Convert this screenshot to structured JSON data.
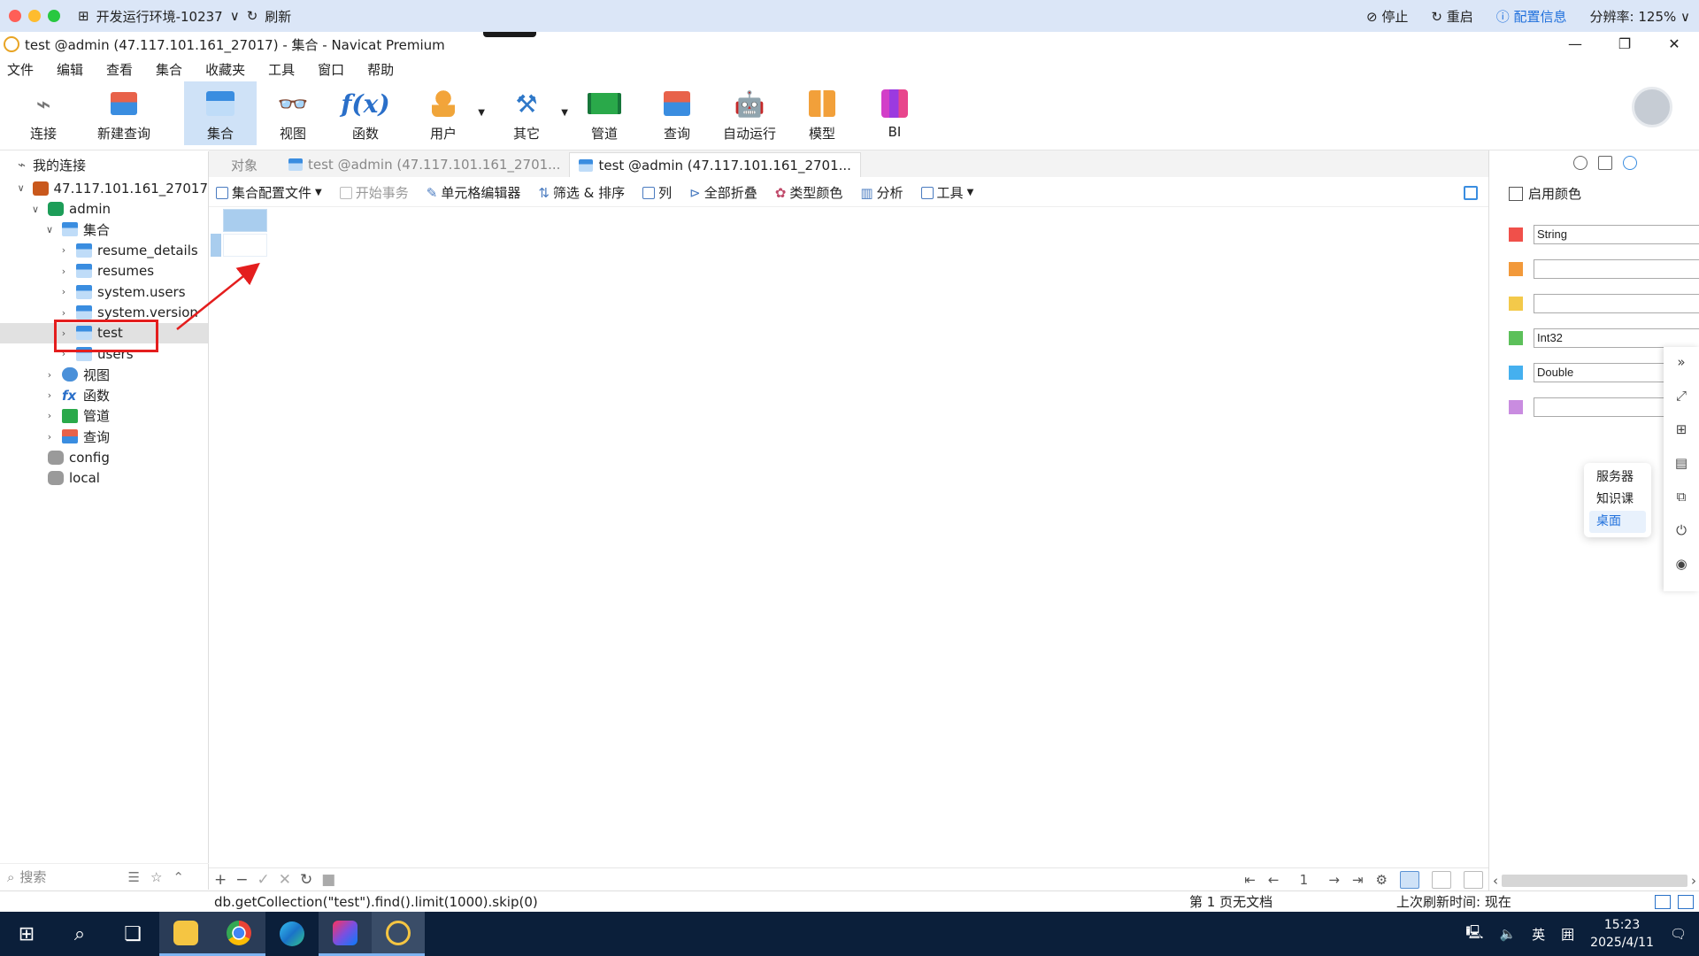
{
  "env": {
    "title": "开发运行环境-10237",
    "refresh": "刷新",
    "stop": "停止",
    "restart": "重启",
    "config": "配置信息",
    "resolution": "分辨率: 125%"
  },
  "window": {
    "title": "test @admin (47.117.101.161_27017) - 集合 - Navicat Premium"
  },
  "menu": [
    "文件",
    "编辑",
    "查看",
    "集合",
    "收藏夹",
    "工具",
    "窗口",
    "帮助"
  ],
  "toolbar": {
    "connect": "连接",
    "new_query": "新建查询",
    "collection": "集合",
    "view": "视图",
    "function": "函数",
    "user": "用户",
    "other": "其它",
    "pipeline": "管道",
    "query": "查询",
    "auto_run": "自动运行",
    "model": "模型",
    "bi": "BI"
  },
  "nav": {
    "header": "我的连接",
    "connection": "47.117.101.161_27017",
    "db_admin": "admin",
    "coll_group": "集合",
    "collections": [
      "resume_details",
      "resumes",
      "system.users",
      "system.version",
      "test",
      "users"
    ],
    "view_group": "视图",
    "func_group": "函数",
    "pipe_group": "管道",
    "query_group": "查询",
    "db_config": "config",
    "db_local": "local",
    "search_placeholder": "搜索"
  },
  "tabs": {
    "objects": "对象",
    "tab1": "test @admin (47.117.101.161_2701...",
    "tab2": "test @admin (47.117.101.161_2701..."
  },
  "subbar": {
    "config_file": "集合配置文件",
    "begin_txn": "开始事务",
    "cell_editor": "单元格编辑器",
    "filter_sort": "筛选 & 排序",
    "columns": "列",
    "collapse_all": "全部折叠",
    "type_color": "类型颜色",
    "analyze": "分析",
    "tools": "工具"
  },
  "pager": {
    "page": "1"
  },
  "right_panel": {
    "enable_color": "启用颜色",
    "colors": [
      {
        "color": "#f0504a",
        "label": "String"
      },
      {
        "color": "#f2993a",
        "label": ""
      },
      {
        "color": "#f3c94a",
        "label": ""
      },
      {
        "color": "#5cc05a",
        "label": "Int32"
      },
      {
        "color": "#45b0ef",
        "label": "Double"
      },
      {
        "color": "#c98ce0",
        "label": ""
      }
    ]
  },
  "popup": {
    "items": [
      "服务器",
      "知识课",
      "桌面"
    ]
  },
  "status": {
    "query": "db.getCollection(\"test\").find().limit(1000).skip(0)",
    "page_info": "第 1 页无文档",
    "last_refresh": "上次刷新时间: 现在"
  },
  "taskbar": {
    "ime": "英",
    "time": "15:23",
    "date": "2025/4/11"
  }
}
